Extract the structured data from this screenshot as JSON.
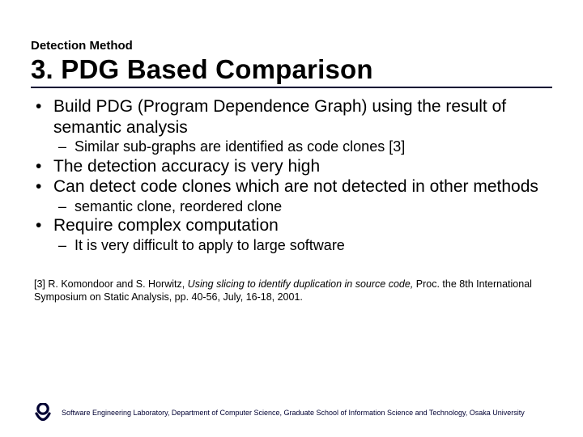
{
  "kicker": "Detection Method",
  "title": "3. PDG Based Comparison",
  "bullets": {
    "b1": "Build PDG (Program Dependence Graph) using the result of semantic analysis",
    "b1a": "Similar sub-graphs are identified as code clones [3]",
    "b2": "The detection accuracy is very high",
    "b3": "Can detect code clones which are not detected in other methods",
    "b3a": "semantic clone, reordered clone",
    "b4": "Require complex computation",
    "b4a": "It is very difficult to apply to large software"
  },
  "citation": {
    "prefix": "[3] R. Komondoor and S. Horwitz, ",
    "italic": "Using slicing to identify duplication in source code, ",
    "suffix": "Proc. the 8th International Symposium on Static Analysis, pp. 40-56, July, 16-18, 2001."
  },
  "footer": "Software Engineering Laboratory, Department of Computer Science, Graduate School of Information Science and Technology, Osaka University"
}
